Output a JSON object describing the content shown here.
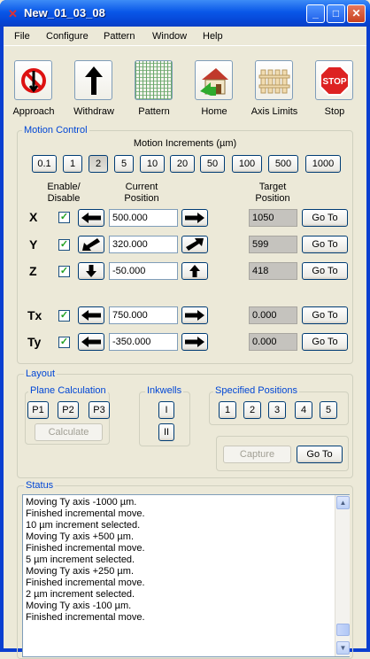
{
  "window": {
    "title": "New_01_03_08"
  },
  "menu": [
    "File",
    "Configure",
    "Pattern",
    "Window",
    "Help"
  ],
  "toolbar": [
    {
      "label": "Approach",
      "icon": "no-entry-icon"
    },
    {
      "label": "Withdraw",
      "icon": "up-arrow-icon"
    },
    {
      "label": "Pattern",
      "icon": "dot-grid-icon"
    },
    {
      "label": "Home",
      "icon": "house-icon"
    },
    {
      "label": "Axis Limits",
      "icon": "fence-icon"
    },
    {
      "label": "Stop",
      "icon": "stop-sign-icon",
      "sign": "STOP"
    }
  ],
  "motion": {
    "title": "Motion Control",
    "increments_label": "Motion Increments (µm)",
    "increments": [
      "0.1",
      "1",
      "2",
      "5",
      "10",
      "20",
      "50",
      "100",
      "500",
      "1000"
    ],
    "selected_increment": "2",
    "col_enable": "Enable/\nDisable",
    "col_current": "Current\nPosition",
    "col_target": "Target\nPosition",
    "goto_label": "Go To",
    "axes": [
      {
        "name": "X",
        "enabled": true,
        "current": "500.000",
        "target": "1050"
      },
      {
        "name": "Y",
        "enabled": true,
        "current": "320.000",
        "target": "599"
      },
      {
        "name": "Z",
        "enabled": true,
        "current": "-50.000",
        "target": "418"
      },
      {
        "name": "Tx",
        "enabled": true,
        "current": "750.000",
        "target": "0.000"
      },
      {
        "name": "Ty",
        "enabled": true,
        "current": "-350.000",
        "target": "0.000"
      }
    ]
  },
  "layout": {
    "title": "Layout",
    "plane_title": "Plane Calculation",
    "plane_buttons": [
      "P1",
      "P2",
      "P3"
    ],
    "calculate": "Calculate",
    "inkwells_title": "Inkwells",
    "inkwells": [
      "I",
      "II"
    ],
    "specified_title": "Specified Positions",
    "specified": [
      "1",
      "2",
      "3",
      "4",
      "5"
    ],
    "capture": "Capture",
    "goto": "Go To"
  },
  "status": {
    "title": "Status",
    "lines": [
      "Moving  Ty axis -1000 µm.",
      "Finished incremental move.",
      "10 µm increment selected.",
      "Moving  Ty axis +500 µm.",
      "Finished incremental move.",
      "5 µm increment selected.",
      "Moving  Ty axis +250 µm.",
      "Finished incremental move.",
      "2 µm increment selected.",
      "Moving  Ty axis -100 µm.",
      "Finished incremental move."
    ]
  }
}
